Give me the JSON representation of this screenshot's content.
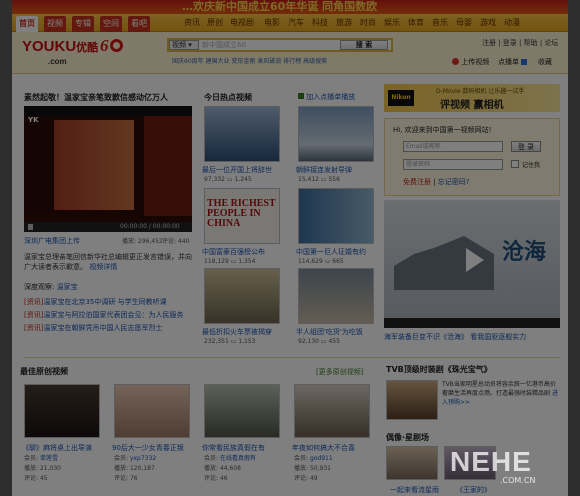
{
  "banner": {
    "text": "…欢庆新中国成立60年华诞   同角国数欧"
  },
  "nav": {
    "tabs": [
      "首页",
      "视频",
      "专辑",
      "空间",
      "看吧"
    ],
    "channels": [
      "资讯",
      "原创",
      "电视剧",
      "电影",
      "汽车",
      "科技",
      "旅游",
      "时尚",
      "娱乐",
      "体育",
      "音乐",
      "母婴",
      "游戏",
      "动漫"
    ]
  },
  "header": {
    "logo": "YOUKU",
    "logo_cn": "优酷",
    "logo_sub": ".com",
    "anniv": "6",
    "search_select": "视频",
    "search_placeholder": "新中国成立60",
    "search_button": "搜 索",
    "quick_links": "国庆60周年 建国大业 变形金刚 乘风破浪 排行榜 高级搜索",
    "top_links": "注册 | 登录 | 帮助 | 论坛",
    "upload": "上传视频",
    "dianhua": "点播单",
    "favorite": "收藏"
  },
  "feature": {
    "title": "素然起敬！温家宝亲笔致歉信感动亿万人",
    "time": "00:00:00 / 00:00:00",
    "uploader": "深圳广电集团上传",
    "plays": "播放: 296,452",
    "comments": "评论: 440",
    "desc": "温家宝总理亲笔回信新华社总编辑更正发言错误，并向广大读者表示歉意。",
    "more": "视频详情",
    "tag_label": "深度观察:",
    "tag": "温家宝",
    "news": [
      {
        "tag": "[资讯]",
        "text": "温家宝在北京35中调研 与学生同教听课"
      },
      {
        "tag": "[资讯]",
        "text": "温家宝与阿拉伯国家代表团会见：为人民服务"
      },
      {
        "tag": "[资讯]",
        "text": "温家宝在朝鲜凭吊中国人民志愿军烈士"
      }
    ]
  },
  "hot": {
    "title": "今日热点视频",
    "subscribe": "加入点播单播放",
    "items": [
      {
        "title": "最后一位开国上将辞世",
        "plays": "97,332",
        "comments": "1,245",
        "caption": ""
      },
      {
        "title": "朝鲜接连发射导弹",
        "plays": "15,412",
        "comments": "556",
        "caption": ""
      },
      {
        "title": "中国富豪百强榜公布",
        "plays": "118,129",
        "comments": "1,354",
        "caption": "THE RICHEST PEOPLE IN CHINA"
      },
      {
        "title": "中国第一巨人征婚有约",
        "plays": "114,629",
        "comments": "665",
        "caption": ""
      },
      {
        "title": "最低折扣火车票被揭穿",
        "plays": "232,351",
        "comments": "1,153",
        "caption": ""
      },
      {
        "title": "半人组团'吃货'为吃饭",
        "plays": "92,130",
        "comments": "455",
        "caption": ""
      }
    ]
  },
  "ads": {
    "banner_top": "D-Movie 数码相机 让乐趣一试手",
    "banner_title": "评视频 赢相机",
    "brand": "Nikon"
  },
  "login": {
    "welcome": "Hi, 欢迎来到中国第一视频网站!",
    "email_placeholder": "Email或昵称",
    "password_placeholder": "登录密码",
    "login_button": "登 录",
    "remember": "记住我",
    "register": "免费注册",
    "forgot": "忘记密码?"
  },
  "promo": {
    "caption": "海军装备巨变不识《沧海》 看我国驱逐舰实力",
    "title_art": "沧海"
  },
  "original": {
    "title": "最佳原创视频",
    "more": "更多原创视频",
    "items": [
      {
        "title": "《聊》麻将桌上出导演",
        "member": "单莲雪",
        "plays": "21,030",
        "comments": "45"
      },
      {
        "title": "90后大一少女青春正叛",
        "member": "yxp7332",
        "plays": "120,187",
        "comments": "76"
      },
      {
        "title": "你常看民族真假在有",
        "member": "在线看真假有",
        "plays": "44,608",
        "comments": "46"
      },
      {
        "title": "年夜如何搞大不合喜",
        "member": "god911",
        "plays": "50,931",
        "comments": "49"
      }
    ],
    "labels": {
      "member": "会员:",
      "plays": "播放:",
      "comments": "评论:"
    }
  },
  "tvb": {
    "title": "TVB顶级时装剧《珠光宝气》",
    "desc": "TVB当家明星总动员将容余辰一亿港币高价奢靡生活再度点燃。打造最强时装精品剧",
    "link": "进入预购>>",
    "section": "偶像·星剧场",
    "items": [
      "一起来看流星雨",
      "《王家的》"
    ]
  },
  "watermark": {
    "big": "NEHE",
    "small": ".COM.CN"
  }
}
